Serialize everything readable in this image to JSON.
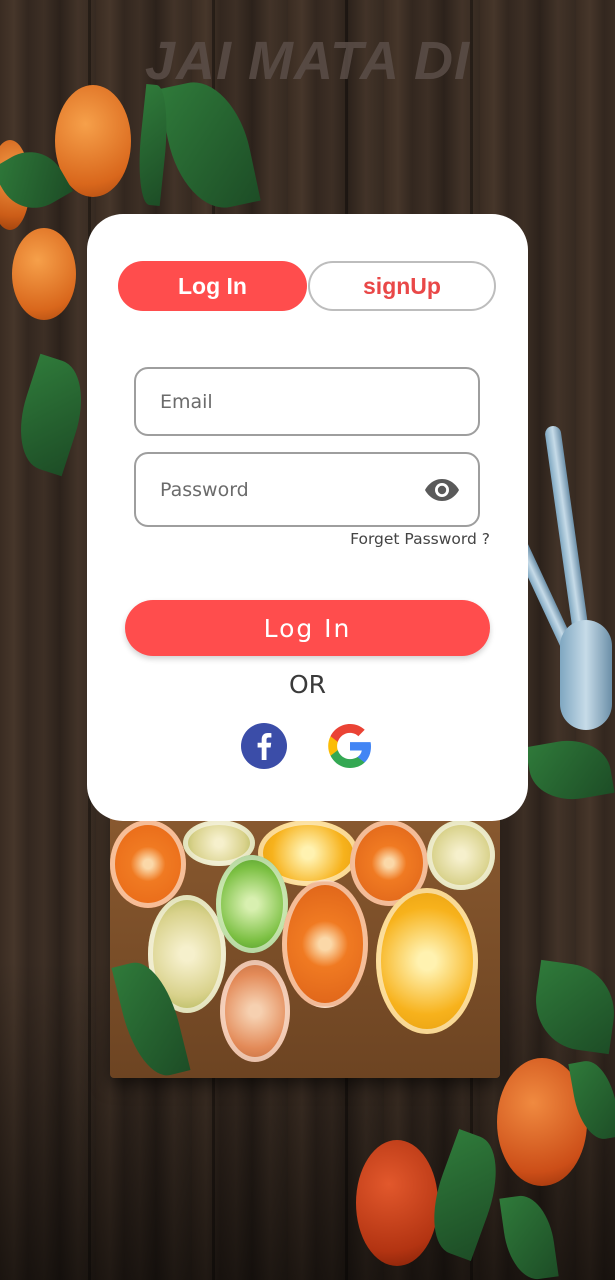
{
  "app": {
    "title": "JAI MATA DI"
  },
  "tabs": {
    "login_label": "Log In",
    "signup_label": "signUp"
  },
  "form": {
    "email_placeholder": "Email",
    "password_placeholder": "Password",
    "password_toggle_icon": "eye-icon",
    "forgot_label": "Forget Password ?",
    "submit_label": "Log In"
  },
  "divider": {
    "or_label": "OR"
  },
  "social": [
    {
      "icon": "facebook-icon"
    },
    {
      "icon": "google-icon"
    }
  ],
  "colors": {
    "accent": "#ff4d4d",
    "signup_text": "#e94848",
    "facebook": "#3b4da8"
  }
}
